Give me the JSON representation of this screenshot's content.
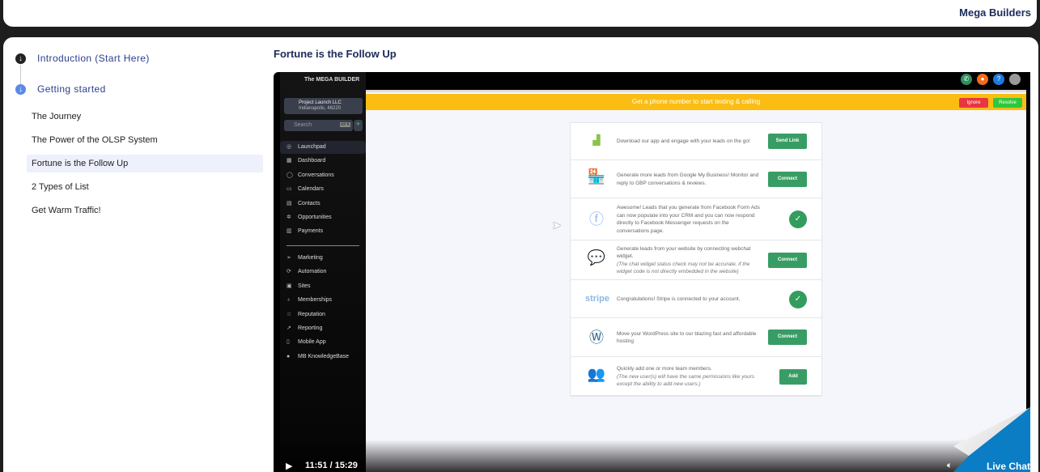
{
  "header": {
    "brand": "Mega Builders"
  },
  "course": {
    "chapters": [
      {
        "label": "Introduction (Start Here)",
        "icon": "arrow-down-circle-icon"
      },
      {
        "label": "Getting started",
        "icon": "arrow-down-circle-icon"
      }
    ],
    "lessons": [
      {
        "label": "The Journey"
      },
      {
        "label": "The Power of the OLSP System"
      },
      {
        "label": "Fortune is the Follow Up",
        "active": true
      },
      {
        "label": "2 Types of List"
      },
      {
        "label": "Get Warm Traffic!"
      }
    ]
  },
  "page": {
    "title": "Fortune is the Follow Up"
  },
  "video": {
    "logo": "The MEGA BUILDER",
    "account": {
      "name": "Project Launch LLC",
      "location": "Indianapolis, 46220"
    },
    "search": {
      "placeholder": "Search",
      "shortcut": "ctrl K"
    },
    "nav": [
      "Launchpad",
      "Dashboard",
      "Conversations",
      "Calendars",
      "Contacts",
      "Opportunities",
      "Payments"
    ],
    "nav2": [
      "Marketing",
      "Automation",
      "Sites",
      "Memberships",
      "Reputation",
      "Reporting",
      "Mobile App",
      "MB KnowledgeBase"
    ],
    "banner": {
      "text": "Get a phone number to start texting & calling",
      "ignore": "Ignore",
      "resolve": "Resolve"
    },
    "rows": [
      {
        "text": "Download our app and engage with your leads on the go!",
        "action": "Send Link"
      },
      {
        "text": "Generate more leads from Google My Business! Monitor and reply to GBP conversations & reviews.",
        "action": "Connect"
      },
      {
        "text": "Awesome! Leads that you generate from Facebook Form Ads can now populate into your CRM and you can now respond directly to Facebook Messenger requests on the conversations page."
      },
      {
        "text": "Generate leads from your website by connecting webchat widget.",
        "note": "(The chat widget status check may not be accurate, if the widget code is not directly embedded in the website)",
        "action": "Connect"
      },
      {
        "text": "Congratulations! Stripe is connected to your account.",
        "logo": "stripe"
      },
      {
        "text": "Move your WordPress site to our blazing fast and affordable hosting",
        "action": "Connect"
      },
      {
        "text": "Quickly add one or more team members.",
        "note": "(The new user(s) will have the same permissions like yours except the ability to add new users.)",
        "action": "Add"
      }
    ],
    "time": "11:51 / 15:29",
    "live_chat": "Live Chat"
  },
  "colors": {
    "accent": "#2b3f8f",
    "banner": "#fbbd12",
    "green": "#389d64",
    "live_chat": "#0a7dc4"
  }
}
